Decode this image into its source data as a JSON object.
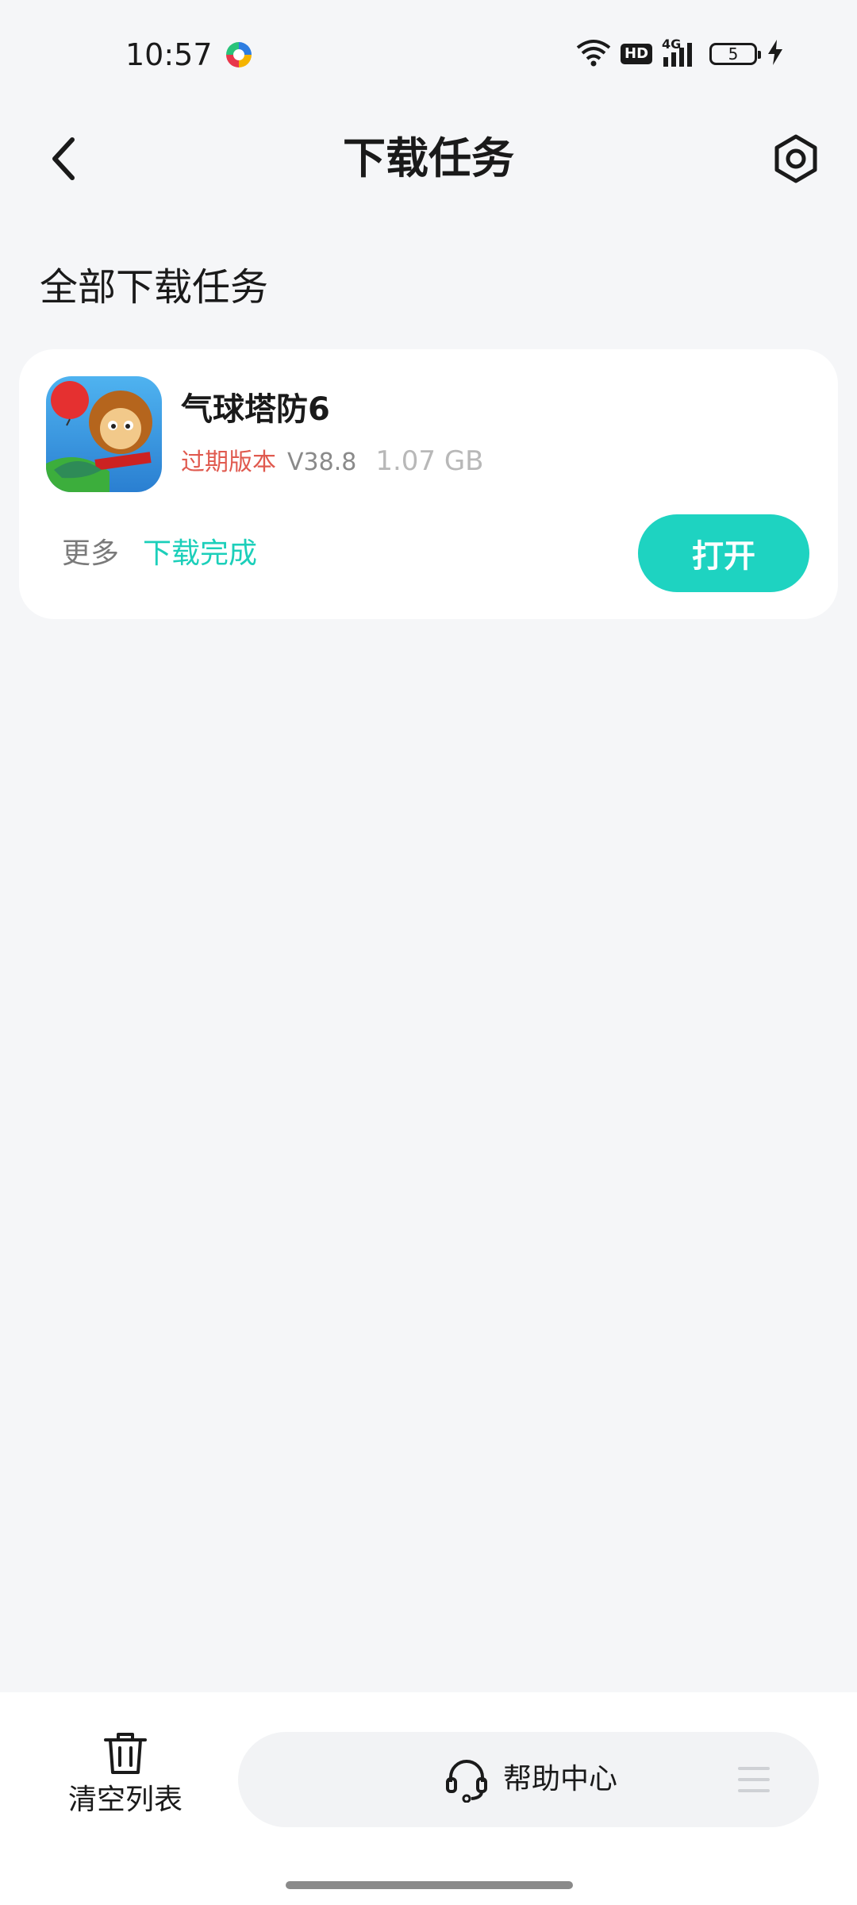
{
  "status_bar": {
    "time": "10:57",
    "hd": "HD",
    "network": "4G",
    "battery": "5"
  },
  "header": {
    "title": "下载任务",
    "back_icon": "chevron-left-icon",
    "settings_icon": "hexagon-settings-icon"
  },
  "section": {
    "title": "全部下载任务"
  },
  "download_items": [
    {
      "name": "气球塔防6",
      "tag": "过期版本",
      "version": "V38.8",
      "size": "1.07 GB",
      "more": "更多",
      "status": "下载完成",
      "action": "打开"
    }
  ],
  "bottom": {
    "clear_label": "清空列表",
    "help_label": "帮助中心"
  },
  "colors": {
    "accent": "#1ed3c1",
    "warning": "#e05a4f",
    "background": "#f5f6f8"
  }
}
